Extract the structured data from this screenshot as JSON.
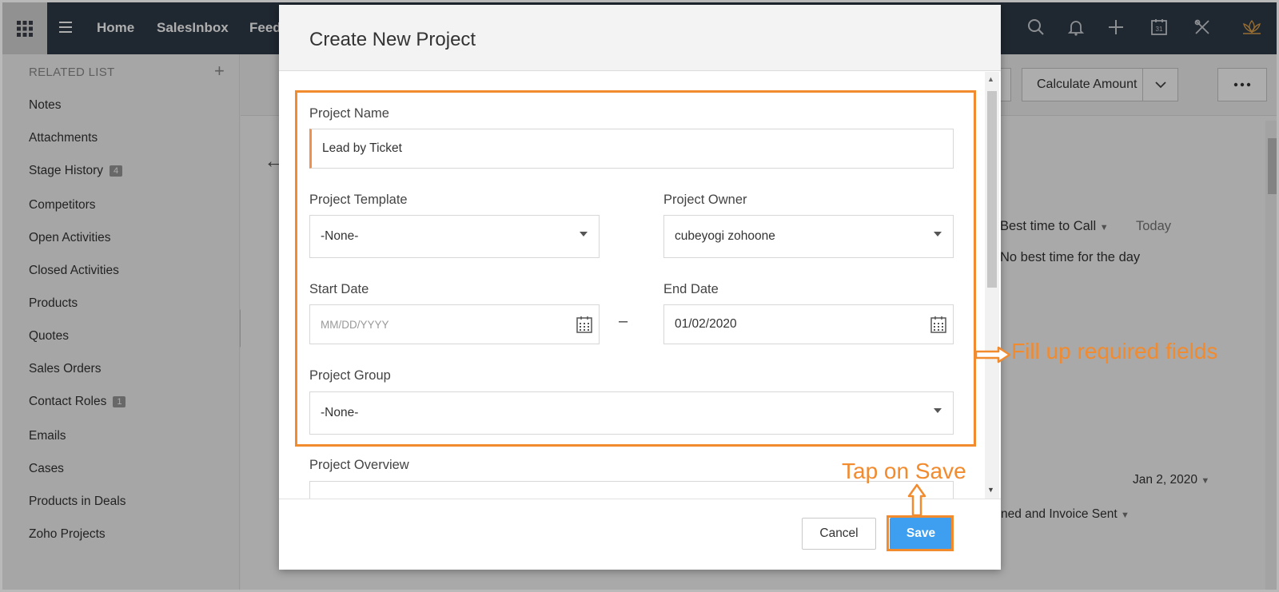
{
  "nav": {
    "items": [
      "Home",
      "SalesInbox",
      "Feeds"
    ]
  },
  "sidebar": {
    "header": "RELATED LIST",
    "items": [
      {
        "label": "Notes"
      },
      {
        "label": "Attachments"
      },
      {
        "label": "Stage History",
        "badge": "4"
      },
      {
        "label": "Competitors"
      },
      {
        "label": "Open Activities"
      },
      {
        "label": "Closed Activities"
      },
      {
        "label": "Products"
      },
      {
        "label": "Quotes"
      },
      {
        "label": "Sales Orders"
      },
      {
        "label": "Contact Roles",
        "badge": "1"
      },
      {
        "label": "Emails"
      },
      {
        "label": "Cases"
      },
      {
        "label": "Products in Deals"
      },
      {
        "label": "Zoho Projects"
      }
    ]
  },
  "main": {
    "calculate_label": "Calculate Amount",
    "best_time_label": "Best time to Call",
    "best_time_value": "Today",
    "best_time_note": "No best time for the day",
    "date_value": "Jan 2, 2020",
    "stage_text": "ned and Invoice Sent"
  },
  "modal": {
    "title": "Create New Project",
    "project_name_label": "Project Name",
    "project_name_value": "Lead by Ticket",
    "template_label": "Project Template",
    "template_value": "-None-",
    "owner_label": "Project Owner",
    "owner_value": "cubeyogi zohoone",
    "start_label": "Start Date",
    "start_placeholder": "MM/DD/YYYY",
    "end_label": "End Date",
    "end_value": "01/02/2020",
    "group_label": "Project Group",
    "group_value": "-None-",
    "overview_label": "Project Overview",
    "cancel_label": "Cancel",
    "save_label": "Save"
  },
  "annotations": {
    "fill_text": "Fill up required fields",
    "save_text": "Tap on Save",
    "color": "#f28a2e"
  },
  "colors": {
    "topbar": "#2f3a48",
    "save_button": "#3e9ff1",
    "required_marker": "#f0904a"
  }
}
